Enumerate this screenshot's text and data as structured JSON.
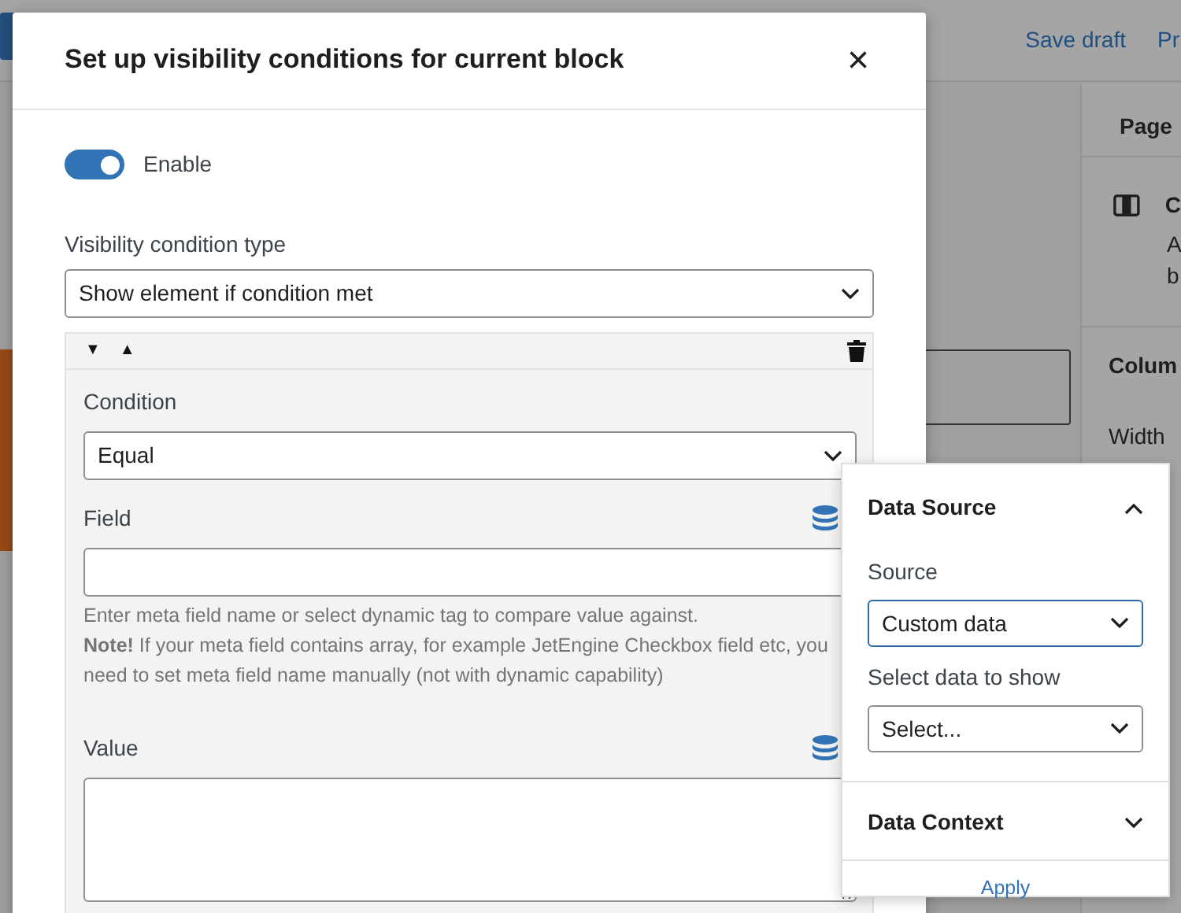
{
  "editor": {
    "top_bar": {
      "links": [
        "Save draft",
        "Pr"
      ]
    },
    "sidebar": {
      "tab": "Page",
      "block_title": "C",
      "block_description": [
        "A",
        "b"
      ],
      "panel_title": "Colum",
      "width_label": "Width"
    }
  },
  "modal": {
    "title": "Set up visibility conditions for current block",
    "close": "×",
    "enable": {
      "label": "Enable",
      "on": true
    },
    "type_label": "Visibility condition type",
    "type_value": "Show element if condition met",
    "condition_group": {
      "down": "▼",
      "up": "▲",
      "condition_label": "Condition",
      "condition_value": "Equal",
      "field_label": "Field",
      "field_help": "Enter meta field name or select dynamic tag to compare value against.",
      "field_note": "**Note!** If your meta field contains array, for example JetEngine Checkbox field etc, you need to set meta field name manually (not with dynamic capability)",
      "value_label": "Value"
    }
  },
  "popover": {
    "sections": [
      {
        "title": "Data Source",
        "expanded": true
      },
      {
        "title": "Data Context",
        "expanded": false
      }
    ],
    "source_label": "Source",
    "source_value": "Custom data",
    "data_label": "Select data to show",
    "data_value": "Select...",
    "apply": "Apply"
  }
}
